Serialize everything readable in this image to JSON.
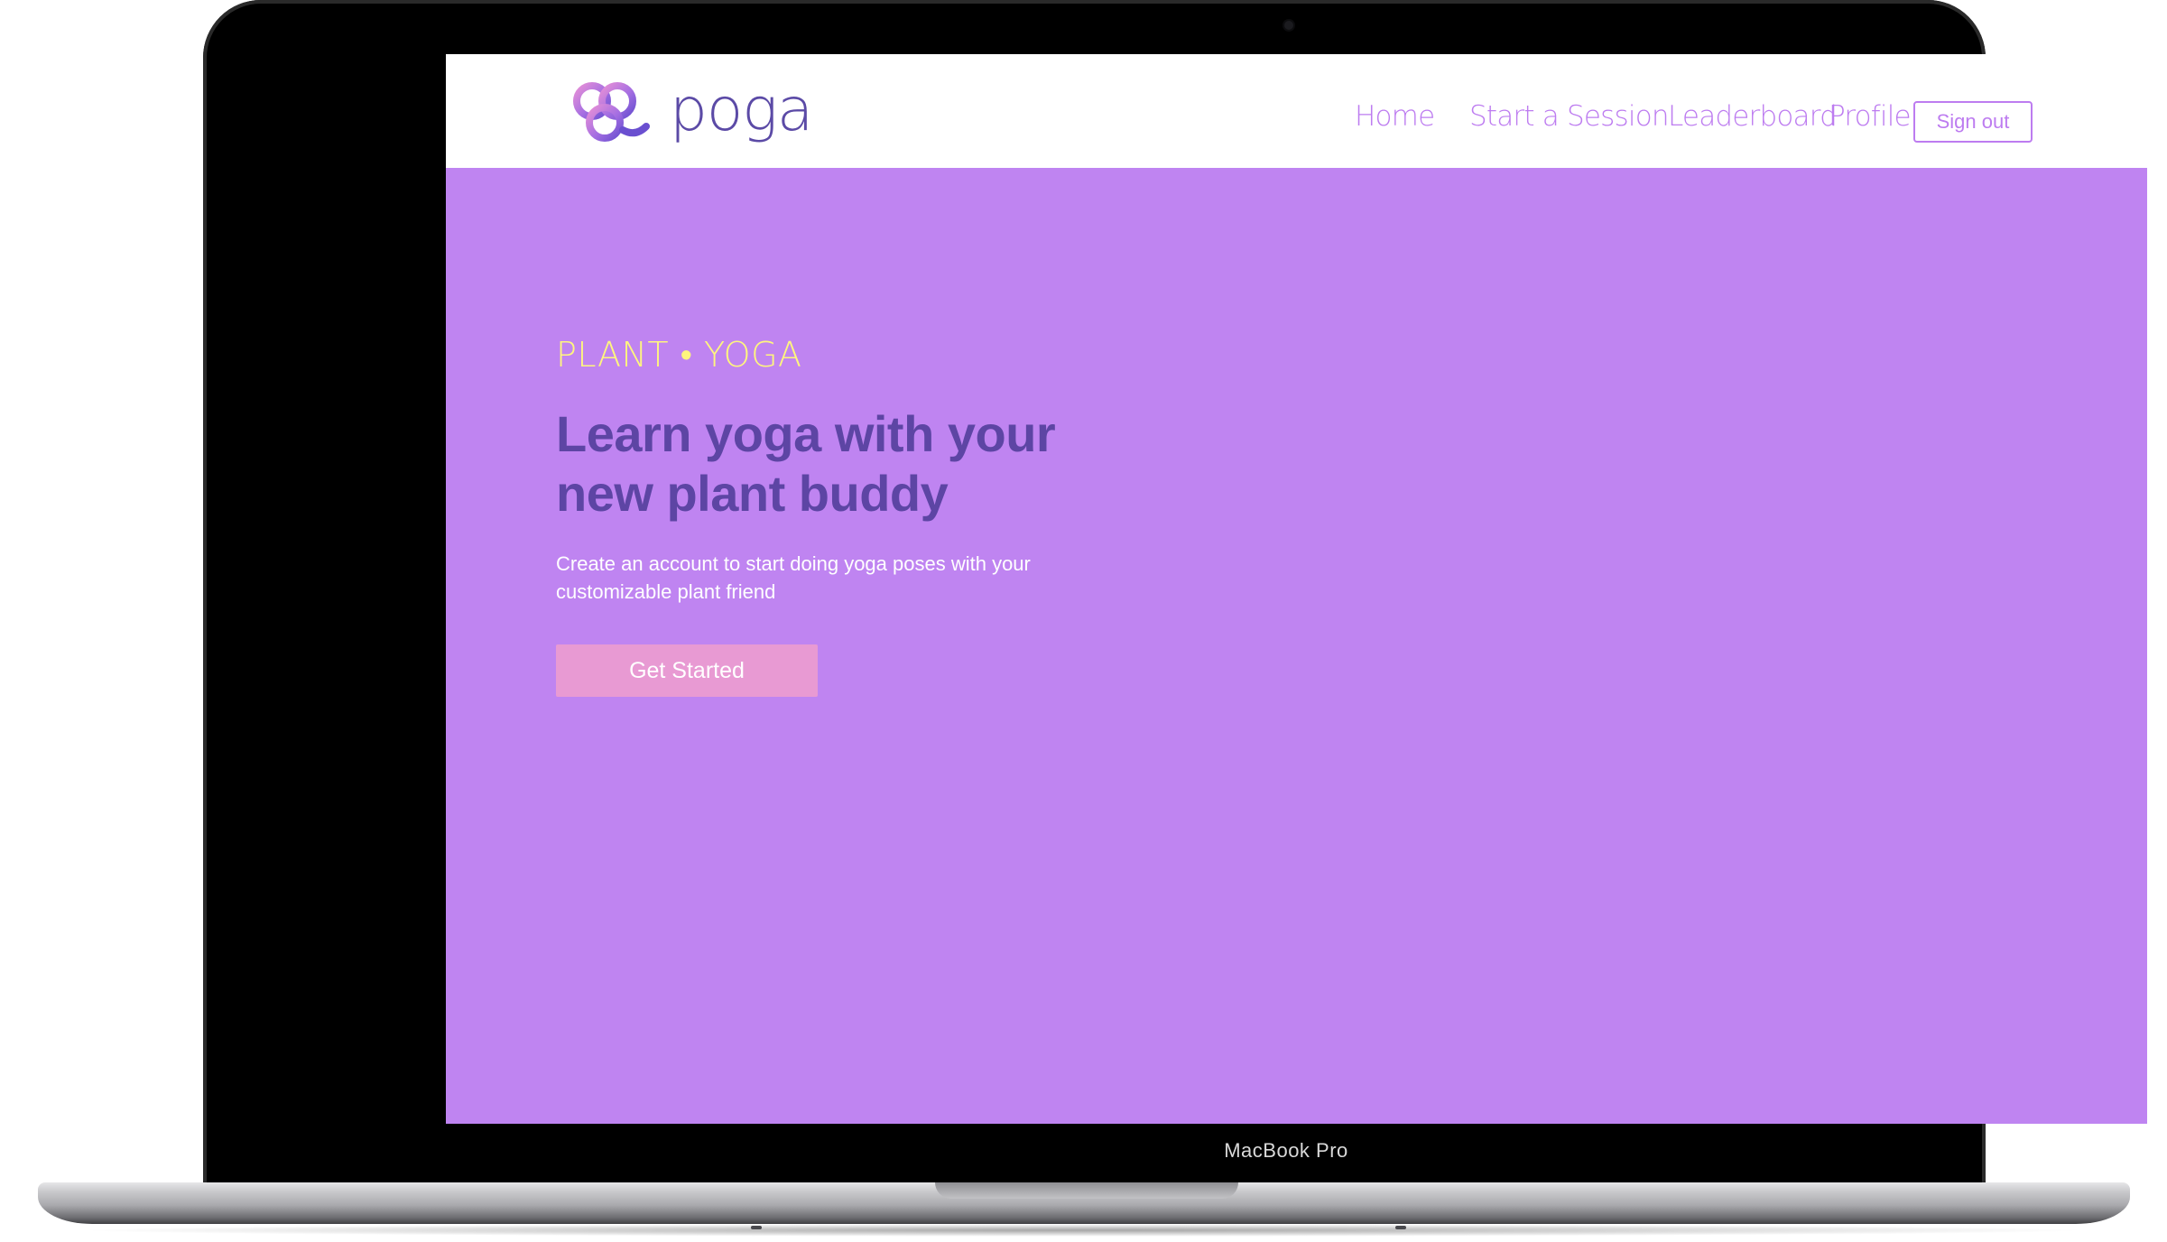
{
  "device": {
    "model_label": "MacBook Pro"
  },
  "brand": {
    "logo_text": "poga",
    "colors": {
      "primary": "#bf84f1",
      "heading": "#5d45a4",
      "accent_yellow": "#fff67d",
      "cta": "#e89ad3",
      "nav": "#bd7cf0"
    }
  },
  "nav": {
    "links": [
      "Home",
      "Start a Session",
      "Leaderboard",
      "Profile"
    ],
    "signout_label": "Sign out"
  },
  "hero": {
    "tagline": "PLANT • YOGA",
    "headline": "Learn yoga with your new plant buddy",
    "subtext": "Create an account to start doing yoga poses with your customizable plant friend",
    "cta_label": "Get Started"
  },
  "icons": {
    "logo_mark": "three-rings-logo-icon"
  }
}
